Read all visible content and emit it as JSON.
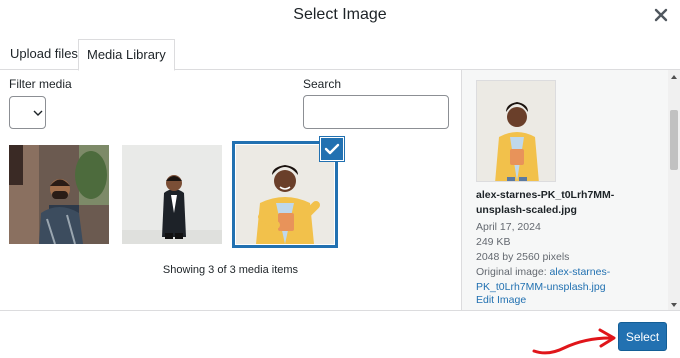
{
  "dialog": {
    "title": "Select Image",
    "close_icon": "close-icon"
  },
  "tabs": [
    {
      "label": "Upload files",
      "active": false
    },
    {
      "label": "Media Library",
      "active": true
    }
  ],
  "toolbar": {
    "filter_label": "Filter media",
    "filter_value": "",
    "search_label": "Search",
    "search_value": ""
  },
  "media_items": [
    {
      "description": "man in plaid shirt",
      "selected": false
    },
    {
      "description": "man in suit",
      "selected": false
    },
    {
      "description": "woman in yellow blazer",
      "selected": true
    }
  ],
  "showing_text": "Showing 3 of 3 media items",
  "details": {
    "filename": "alex-starnes-PK_t0Lrh7MM-unsplash-scaled.jpg",
    "date": "April 17, 2024",
    "size": "249 KB",
    "dimensions": "2048 by 2560 pixels",
    "original_label": "Original image:",
    "original_link": "alex-starnes-PK_t0Lrh7MM-unsplash.jpg",
    "edit_link": "Edit Image"
  },
  "footer": {
    "select_label": "Select"
  },
  "colors": {
    "accent": "#2271b1",
    "annotation_arrow": "#e0151a"
  }
}
